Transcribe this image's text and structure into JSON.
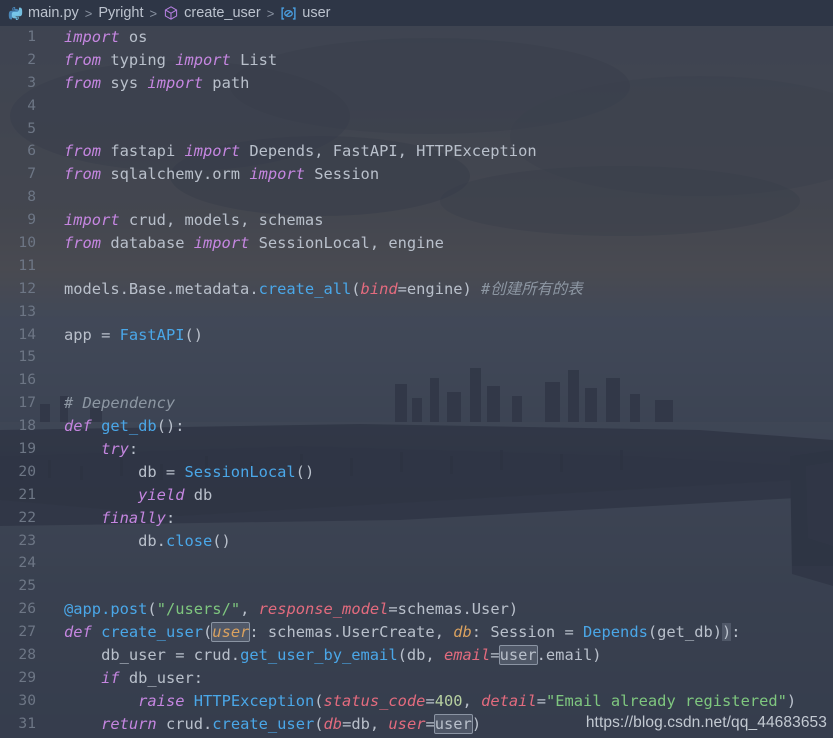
{
  "breadcrumb": {
    "items": [
      {
        "label": "main.py",
        "icon": "python-icon"
      },
      {
        "label": "Pyright",
        "icon": "none"
      },
      {
        "label": "create_user",
        "icon": "symbol-method-icon"
      },
      {
        "label": "user",
        "icon": "symbol-variable-icon"
      }
    ],
    "separator": ">"
  },
  "watermark": {
    "text": "https://blog.csdn.net/qq_44683653"
  },
  "colors": {
    "editor_background": "#2b3244",
    "breadcrumb_background": "#2e3646",
    "line_number": "#6d7685",
    "keyword": "#c586e0",
    "function": "#4aa7e8",
    "parameter": "#e36b7e",
    "string": "#7fc77f",
    "comment": "#8d97a3",
    "variable_italic": "#d9a15f",
    "plain_text": "#b9c0cb",
    "occurrence_highlight": "#8b94a3"
  },
  "editor": {
    "language": "python",
    "file_name": "main.py",
    "first_visible_line": 1,
    "last_visible_line": 31,
    "lines": [
      {
        "n": 1,
        "tokens": [
          {
            "t": "import",
            "c": "t-kw"
          },
          {
            "t": " os",
            "c": "t-plain"
          }
        ]
      },
      {
        "n": 2,
        "tokens": [
          {
            "t": "from",
            "c": "t-kw"
          },
          {
            "t": " typing ",
            "c": "t-plain"
          },
          {
            "t": "import",
            "c": "t-kw"
          },
          {
            "t": " List",
            "c": "t-plain"
          }
        ]
      },
      {
        "n": 3,
        "tokens": [
          {
            "t": "from",
            "c": "t-kw"
          },
          {
            "t": " sys ",
            "c": "t-plain"
          },
          {
            "t": "import",
            "c": "t-kw"
          },
          {
            "t": " path",
            "c": "t-plain"
          }
        ]
      },
      {
        "n": 4,
        "tokens": []
      },
      {
        "n": 5,
        "tokens": []
      },
      {
        "n": 6,
        "tokens": [
          {
            "t": "from",
            "c": "t-kw"
          },
          {
            "t": " fastapi ",
            "c": "t-plain"
          },
          {
            "t": "import",
            "c": "t-kw"
          },
          {
            "t": " Depends, FastAPI, HTTPException",
            "c": "t-plain"
          }
        ]
      },
      {
        "n": 7,
        "tokens": [
          {
            "t": "from",
            "c": "t-kw"
          },
          {
            "t": " sqlalchemy.orm ",
            "c": "t-plain"
          },
          {
            "t": "import",
            "c": "t-kw"
          },
          {
            "t": " Session",
            "c": "t-plain"
          }
        ]
      },
      {
        "n": 8,
        "tokens": []
      },
      {
        "n": 9,
        "tokens": [
          {
            "t": "import",
            "c": "t-kw"
          },
          {
            "t": " crud, models, schemas",
            "c": "t-plain"
          }
        ]
      },
      {
        "n": 10,
        "tokens": [
          {
            "t": "from",
            "c": "t-kw"
          },
          {
            "t": " database ",
            "c": "t-plain"
          },
          {
            "t": "import",
            "c": "t-kw"
          },
          {
            "t": " SessionLocal, engine",
            "c": "t-plain"
          }
        ]
      },
      {
        "n": 11,
        "tokens": []
      },
      {
        "n": 12,
        "tokens": [
          {
            "t": "models.Base.metadata.",
            "c": "t-plain"
          },
          {
            "t": "create_all",
            "c": "t-fn"
          },
          {
            "t": "(",
            "c": "t-punc"
          },
          {
            "t": "bind",
            "c": "t-param"
          },
          {
            "t": "=engine) ",
            "c": "t-plain"
          },
          {
            "t": "#创建所有的表",
            "c": "t-com"
          }
        ]
      },
      {
        "n": 13,
        "tokens": []
      },
      {
        "n": 14,
        "tokens": [
          {
            "t": "app = ",
            "c": "t-plain"
          },
          {
            "t": "FastAPI",
            "c": "t-fn"
          },
          {
            "t": "()",
            "c": "t-punc"
          }
        ]
      },
      {
        "n": 15,
        "tokens": []
      },
      {
        "n": 16,
        "tokens": []
      },
      {
        "n": 17,
        "tokens": [
          {
            "t": "# Dependency",
            "c": "t-com"
          }
        ]
      },
      {
        "n": 18,
        "tokens": [
          {
            "t": "def ",
            "c": "t-kw"
          },
          {
            "t": "get_db",
            "c": "t-fn"
          },
          {
            "t": "():",
            "c": "t-punc"
          }
        ]
      },
      {
        "n": 19,
        "tokens": [
          {
            "t": "    ",
            "c": "t-plain"
          },
          {
            "t": "try",
            "c": "t-kw"
          },
          {
            "t": ":",
            "c": "t-punc"
          }
        ]
      },
      {
        "n": 20,
        "tokens": [
          {
            "t": "        db = ",
            "c": "t-plain"
          },
          {
            "t": "SessionLocal",
            "c": "t-fn"
          },
          {
            "t": "()",
            "c": "t-punc"
          }
        ]
      },
      {
        "n": 21,
        "tokens": [
          {
            "t": "        ",
            "c": "t-plain"
          },
          {
            "t": "yield",
            "c": "t-kw"
          },
          {
            "t": " db",
            "c": "t-plain"
          }
        ]
      },
      {
        "n": 22,
        "tokens": [
          {
            "t": "    ",
            "c": "t-plain"
          },
          {
            "t": "finally",
            "c": "t-kw"
          },
          {
            "t": ":",
            "c": "t-punc"
          }
        ]
      },
      {
        "n": 23,
        "tokens": [
          {
            "t": "        db.",
            "c": "t-plain"
          },
          {
            "t": "close",
            "c": "t-fn"
          },
          {
            "t": "()",
            "c": "t-punc"
          }
        ]
      },
      {
        "n": 24,
        "tokens": []
      },
      {
        "n": 25,
        "tokens": []
      },
      {
        "n": 26,
        "tokens": [
          {
            "t": "@app.",
            "c": "t-fn"
          },
          {
            "t": "post",
            "c": "t-fn"
          },
          {
            "t": "(",
            "c": "t-punc"
          },
          {
            "t": "\"/users/\"",
            "c": "t-str"
          },
          {
            "t": ", ",
            "c": "t-punc"
          },
          {
            "t": "response_model",
            "c": "t-param"
          },
          {
            "t": "=schemas.User)",
            "c": "t-plain"
          }
        ]
      },
      {
        "n": 27,
        "tokens": [
          {
            "t": "def ",
            "c": "t-kw"
          },
          {
            "t": "create_user",
            "c": "t-fn"
          },
          {
            "t": "(",
            "c": "t-punc"
          },
          {
            "t": "user",
            "c": "t-self hl"
          },
          {
            "t": ": schemas.UserCreate, ",
            "c": "t-plain"
          },
          {
            "t": "db",
            "c": "t-self"
          },
          {
            "t": ": Session = ",
            "c": "t-plain"
          },
          {
            "t": "Depends",
            "c": "t-fn"
          },
          {
            "t": "(get_db",
            "c": "t-plain"
          },
          {
            "t": ")",
            "c": "t-punc"
          },
          {
            "t": ")",
            "c": "t-punc hl-brace"
          },
          {
            "t": ":",
            "c": "t-punc"
          }
        ]
      },
      {
        "n": 28,
        "tokens": [
          {
            "t": "    db_user = crud.",
            "c": "t-plain"
          },
          {
            "t": "get_user_by_email",
            "c": "t-fn"
          },
          {
            "t": "(db, ",
            "c": "t-plain"
          },
          {
            "t": "email",
            "c": "t-param"
          },
          {
            "t": "=",
            "c": "t-plain"
          },
          {
            "t": "user",
            "c": "t-plain hl"
          },
          {
            "t": ".email)",
            "c": "t-plain"
          }
        ]
      },
      {
        "n": 29,
        "tokens": [
          {
            "t": "    ",
            "c": "t-plain"
          },
          {
            "t": "if",
            "c": "t-kw"
          },
          {
            "t": " db_user:",
            "c": "t-plain"
          }
        ]
      },
      {
        "n": 30,
        "tokens": [
          {
            "t": "        ",
            "c": "t-plain"
          },
          {
            "t": "raise",
            "c": "t-kw"
          },
          {
            "t": " ",
            "c": "t-plain"
          },
          {
            "t": "HTTPException",
            "c": "t-fn"
          },
          {
            "t": "(",
            "c": "t-punc"
          },
          {
            "t": "status_code",
            "c": "t-param"
          },
          {
            "t": "=",
            "c": "t-plain"
          },
          {
            "t": "400",
            "c": "t-num"
          },
          {
            "t": ", ",
            "c": "t-plain"
          },
          {
            "t": "detail",
            "c": "t-param"
          },
          {
            "t": "=",
            "c": "t-plain"
          },
          {
            "t": "\"Email already registered\"",
            "c": "t-str"
          },
          {
            "t": ")",
            "c": "t-punc"
          }
        ]
      },
      {
        "n": 31,
        "tokens": [
          {
            "t": "    ",
            "c": "t-plain"
          },
          {
            "t": "return",
            "c": "t-kw"
          },
          {
            "t": " crud.",
            "c": "t-plain"
          },
          {
            "t": "create_user",
            "c": "t-fn"
          },
          {
            "t": "(",
            "c": "t-punc"
          },
          {
            "t": "db",
            "c": "t-param"
          },
          {
            "t": "=db, ",
            "c": "t-plain"
          },
          {
            "t": "user",
            "c": "t-param"
          },
          {
            "t": "=",
            "c": "t-plain"
          },
          {
            "t": "user",
            "c": "t-plain hl"
          },
          {
            "t": ")",
            "c": "t-punc"
          }
        ]
      }
    ]
  }
}
